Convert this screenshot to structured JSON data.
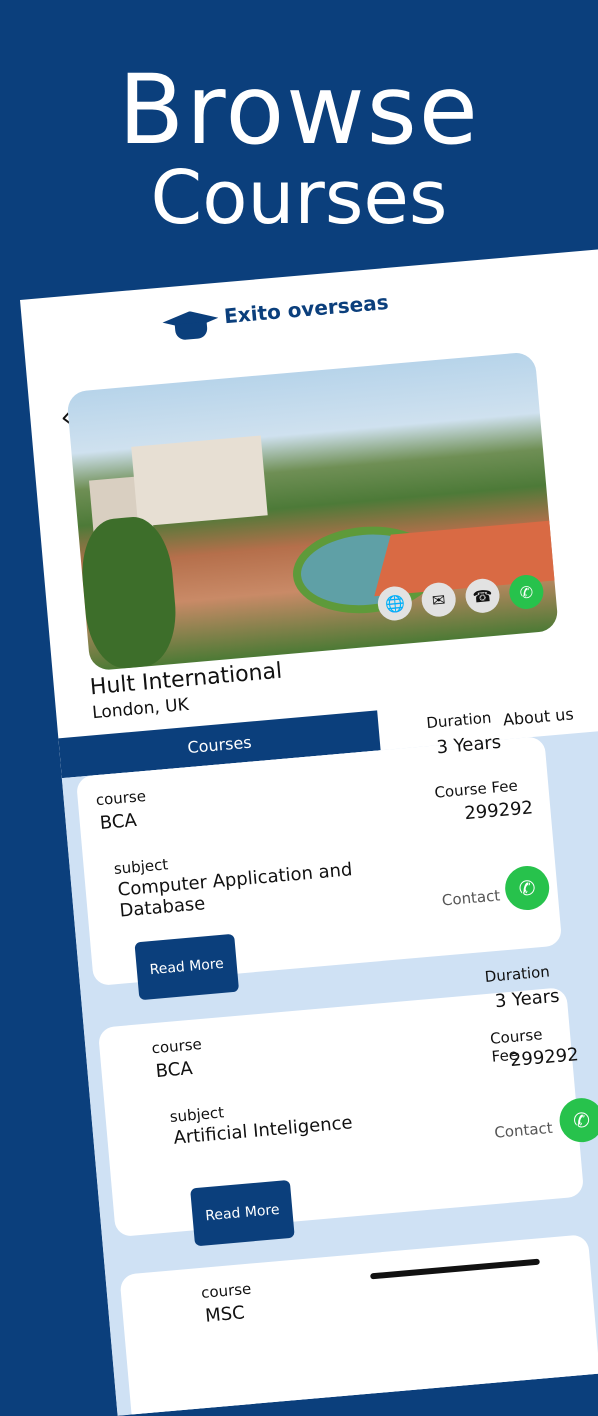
{
  "hero": {
    "line1": "Browse",
    "line2": "Courses"
  },
  "app": {
    "logo_text": "Exito overseas"
  },
  "university": {
    "name": "Hult International",
    "location": "London, UK"
  },
  "actions": [
    {
      "name": "globe-icon",
      "glyph": "🌐"
    },
    {
      "name": "mail-icon",
      "glyph": "✉"
    },
    {
      "name": "phone-icon",
      "glyph": "☎"
    },
    {
      "name": "whatsapp-icon",
      "glyph": "✆"
    }
  ],
  "tabs": {
    "courses": "Courses",
    "about": "About us"
  },
  "labels": {
    "course": "course",
    "subject": "subject",
    "duration": "Duration",
    "fee": "Course Fee",
    "contact": "Contact",
    "read_more": "Read More"
  },
  "courses": [
    {
      "course": "BCA",
      "subject": "Computer Application and Database",
      "duration": "3 Years",
      "fee": "299292"
    },
    {
      "course": "BCA",
      "subject": "Artificial Inteligence",
      "duration": "3 Years",
      "fee": "299292"
    },
    {
      "course": "MSC"
    }
  ],
  "colors": {
    "brand": "#0b3f7c",
    "whatsapp": "#27c24c",
    "list_bg": "#cfe1f4"
  }
}
